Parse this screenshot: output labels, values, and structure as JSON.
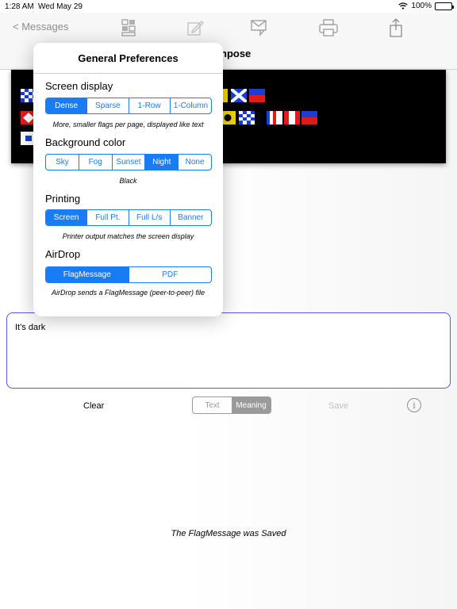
{
  "status": {
    "time": "1:28 AM",
    "date": "Wed May 29",
    "battery": "100%"
  },
  "nav": {
    "back_label": "< Messages",
    "title_partial": "npose"
  },
  "colors": {
    "accent": "#1a7cf5",
    "night_bg": "#000000",
    "textarea_border": "#5a5ad6"
  },
  "message": {
    "text": "It’s dark"
  },
  "bottom": {
    "clear": "Clear",
    "save": "Save",
    "seg_text": "Text",
    "seg_meaning": "Meaning",
    "selected": "Meaning"
  },
  "saved_notice": "The FlagMessage was Saved",
  "prefs": {
    "title": "General Preferences",
    "screen_display": {
      "label": "Screen display",
      "options": [
        "Dense",
        "Sparse",
        "1-Row",
        "1-Column"
      ],
      "selected": "Dense",
      "caption": "More, smaller flags per page, displayed like text"
    },
    "background": {
      "label": "Background color",
      "options": [
        "Sky",
        "Fog",
        "Sunset",
        "Night",
        "None"
      ],
      "selected": "Night",
      "caption": "Black"
    },
    "printing": {
      "label": "Printing",
      "options": [
        "Screen",
        "Full Pt.",
        "Full L/s",
        "Banner"
      ],
      "selected": "Screen",
      "caption": "Printer output matches the screen display"
    },
    "airdrop": {
      "label": "AirDrop",
      "options": [
        "FlagMessage",
        "PDF"
      ],
      "selected": "FlagMessage",
      "caption": "AirDrop sends a FlagMessage (peer-to-peer) file"
    }
  },
  "icons": [
    "wifi-icon",
    "battery-icon",
    "flags-icon",
    "compose-icon",
    "message-icon",
    "printer-icon",
    "share-icon",
    "info-icon"
  ]
}
